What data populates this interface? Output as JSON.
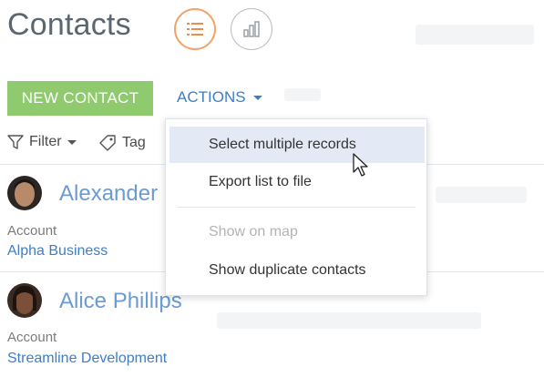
{
  "header": {
    "title": "Contacts",
    "view_buttons": [
      {
        "icon": "list-view-icon",
        "active": true
      },
      {
        "icon": "chart-view-icon",
        "active": false
      }
    ]
  },
  "toolbar": {
    "new_label": "NEW CONTACT",
    "actions_label": "ACTIONS"
  },
  "filter_bar": {
    "filter_label": "Filter",
    "tag_label": "Tag"
  },
  "contacts": [
    {
      "name": "Alexander",
      "account_label": "Account",
      "account": "Alpha Business"
    },
    {
      "name": "Alice Phillips",
      "account_label": "Account",
      "account": "Streamline Development"
    }
  ],
  "actions_menu": {
    "items": [
      {
        "label": "Select multiple records",
        "state": "hover"
      },
      {
        "label": "Export list to file",
        "state": "normal"
      },
      {
        "label": "Show on map",
        "state": "disabled"
      },
      {
        "label": "Show duplicate contacts",
        "state": "normal"
      }
    ]
  },
  "colors": {
    "new_button": "#8fca6e",
    "accent_blue": "#3f7ec4",
    "active_view_border": "#f4a36b",
    "menu_hover": "#e3eaf5"
  }
}
